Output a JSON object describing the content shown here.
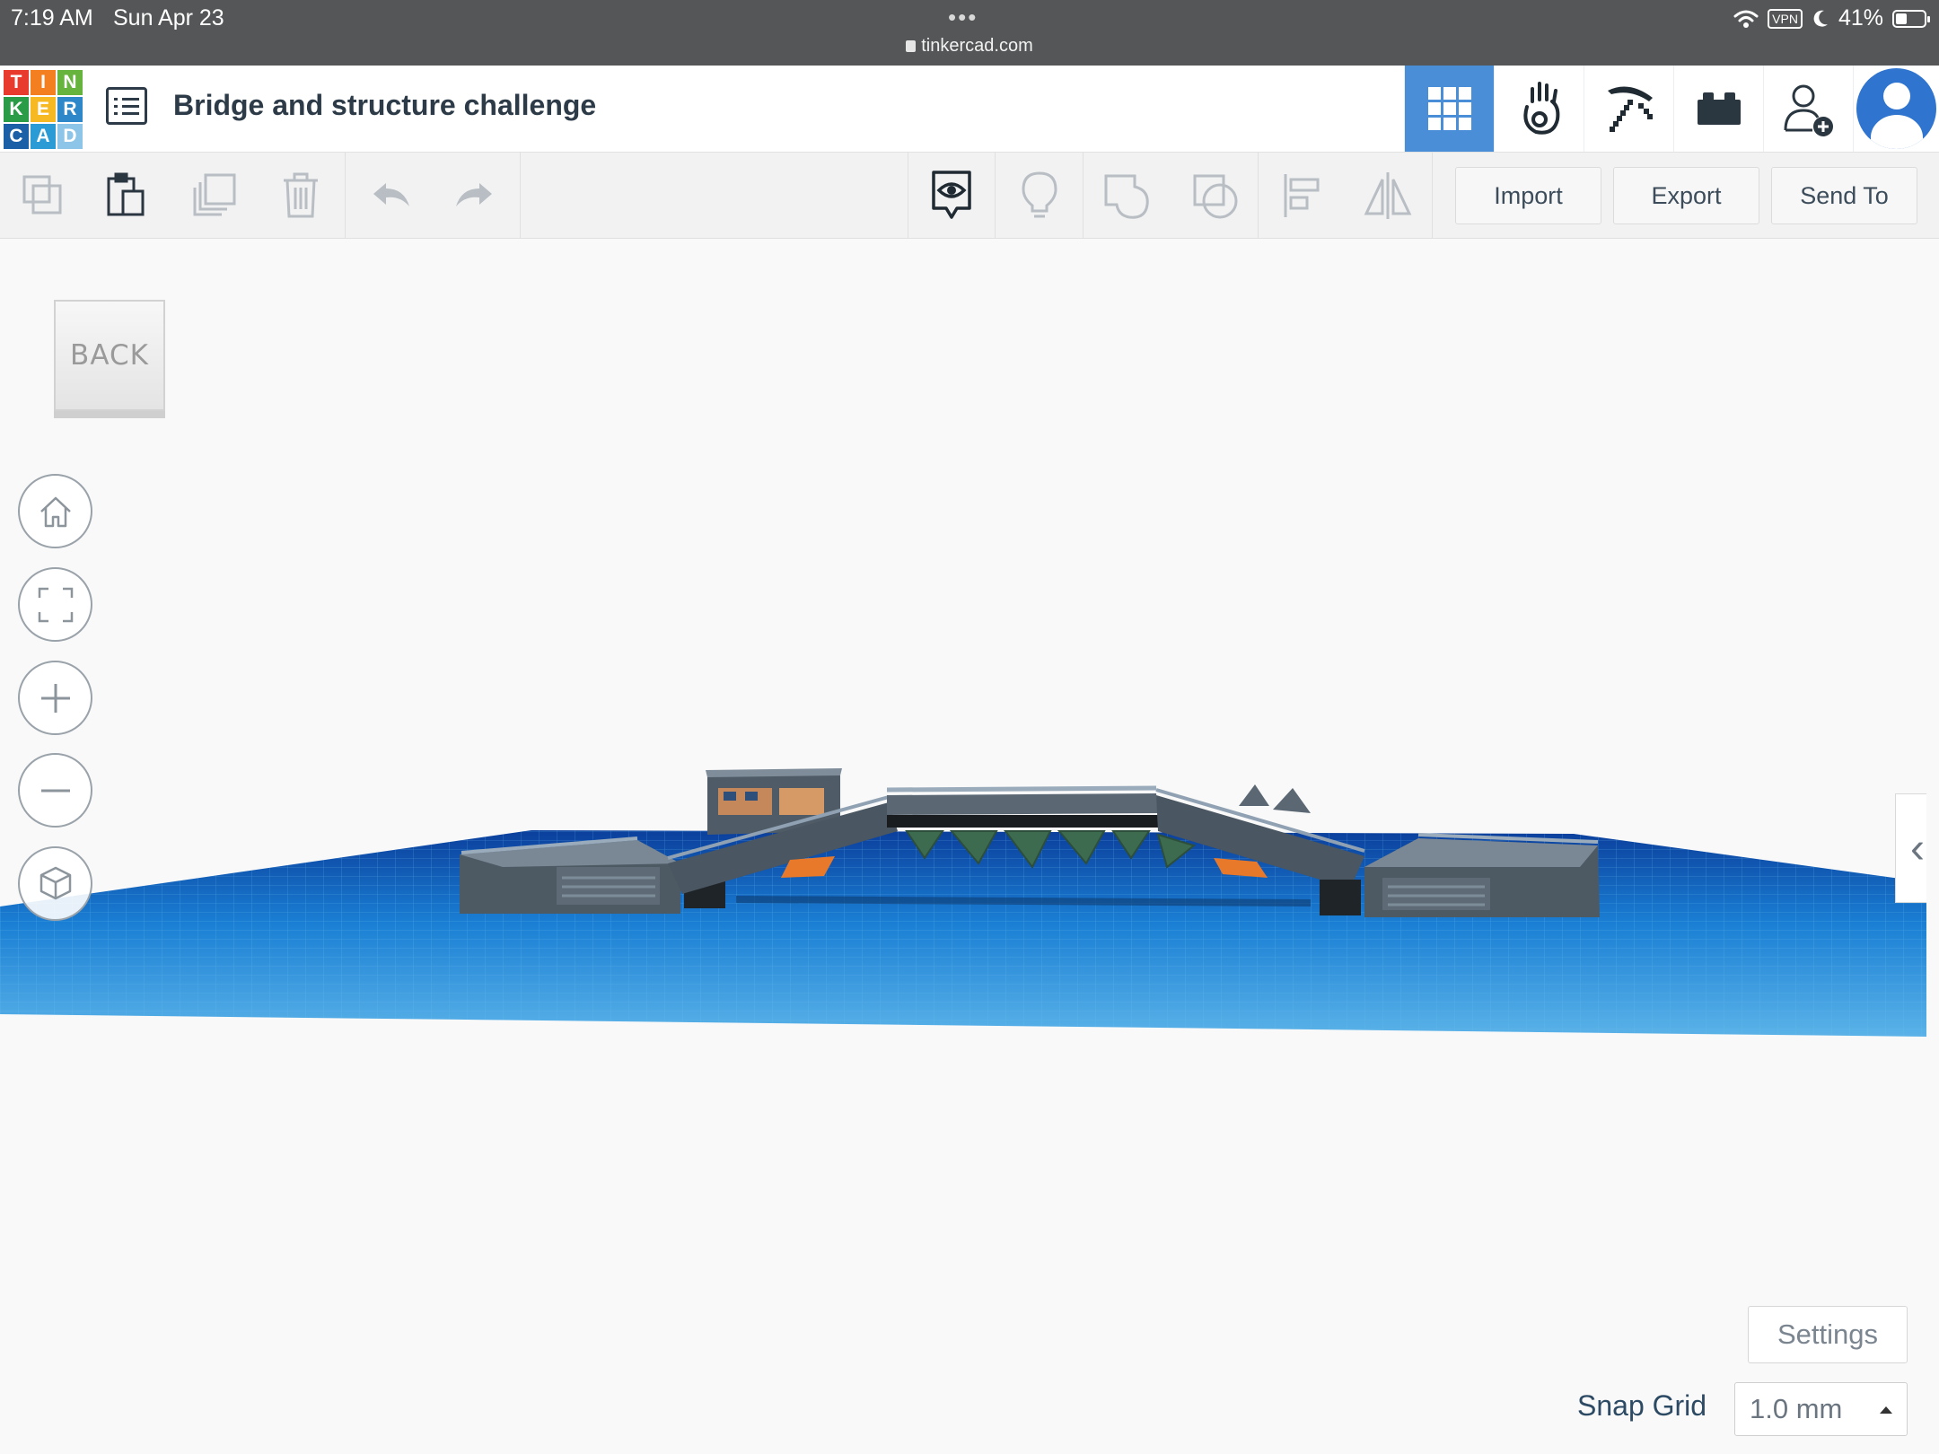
{
  "status_bar": {
    "time": "7:19 AM",
    "date": "Sun Apr 23",
    "dots": "•••",
    "url": "tinkercad.com",
    "vpn": "VPN",
    "battery_text": "41%",
    "battery_level": 0.41
  },
  "header": {
    "logo_letters": [
      "T",
      "I",
      "N",
      "K",
      "E",
      "R",
      "C",
      "A",
      "D"
    ],
    "logo_colors": [
      "#e83b2e",
      "#f47f21",
      "#66b33d",
      "#2a9b47",
      "#f6b823",
      "#2d87c8",
      "#1b5fa6",
      "#2b9bd6",
      "#8dc5e8"
    ],
    "title": "Bridge and structure challenge",
    "tabs": [
      "3d-design-view-icon",
      "blocks-view-icon",
      "bricks-view-icon",
      "lego-view-icon",
      "invite-user-icon",
      "avatar"
    ],
    "active_tab": "3d-design-view-icon",
    "accent": "#4b8ed8"
  },
  "toolbar": {
    "import_label": "Import",
    "export_label": "Export",
    "send_to_label": "Send To"
  },
  "viewcube": {
    "label": "BACK"
  },
  "nav_buttons": [
    "home-view-icon",
    "fit-all-icon",
    "zoom-in-icon",
    "zoom-out-icon",
    "ortho-view-icon"
  ],
  "footer": {
    "settings_label": "Settings",
    "snap_grid_label": "Snap Grid",
    "snap_grid_value": "1.0 mm"
  },
  "colors": {
    "workplane_blue": "#1a7fd4",
    "workplane_light": "#5ab2e8",
    "bridge_gray": "#4d5a64",
    "accent_orange": "#e8792a"
  }
}
